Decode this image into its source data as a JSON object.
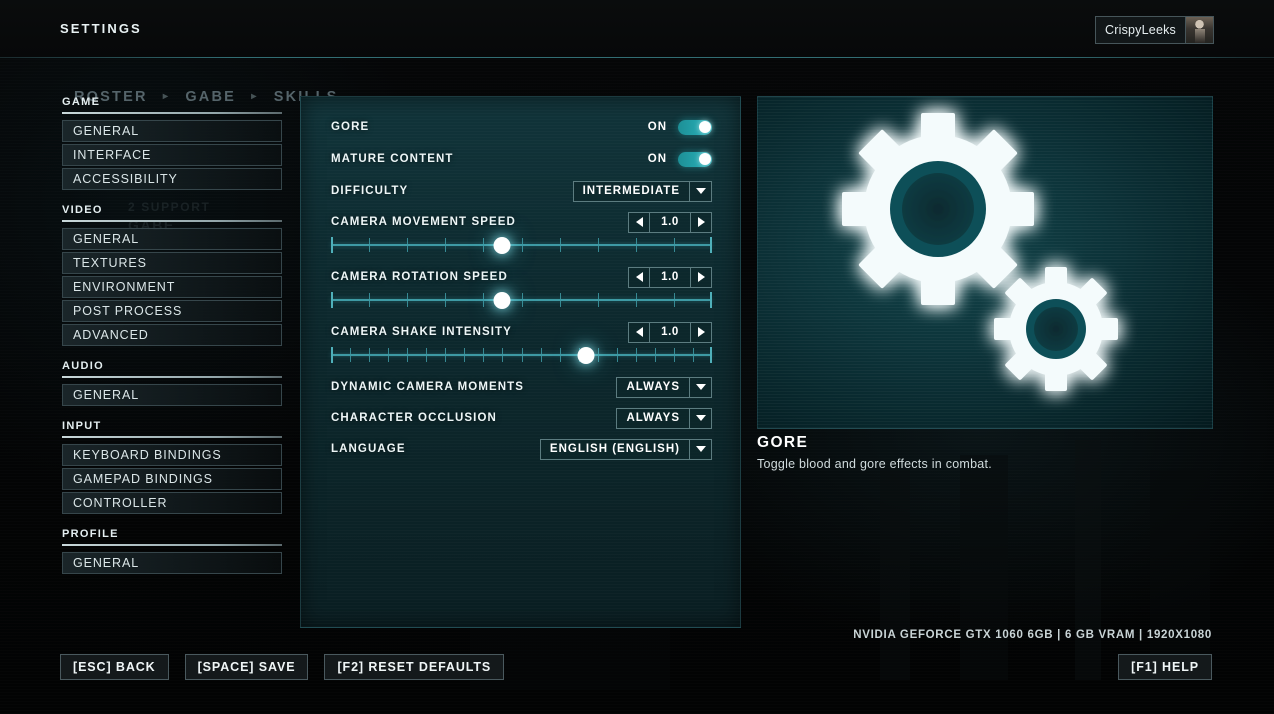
{
  "topbar": {
    "title": "SETTINGS",
    "user": {
      "name": "CrispyLeeks",
      "avatar_icon": "character-portrait-icon"
    }
  },
  "breadcrumb": {
    "items": [
      "ROSTER",
      "GABE",
      "SKILLS"
    ],
    "separator": "▸"
  },
  "background_ghost": {
    "support_label": "2 SUPPORT",
    "gabe_label": "GABE"
  },
  "sidebar": {
    "groups": [
      {
        "title": "GAME",
        "items": [
          "GENERAL",
          "INTERFACE",
          "ACCESSIBILITY"
        ]
      },
      {
        "title": "VIDEO",
        "items": [
          "GENERAL",
          "TEXTURES",
          "ENVIRONMENT",
          "POST PROCESS",
          "ADVANCED"
        ]
      },
      {
        "title": "AUDIO",
        "items": [
          "GENERAL"
        ]
      },
      {
        "title": "INPUT",
        "items": [
          "KEYBOARD BINDINGS",
          "GAMEPAD BINDINGS",
          "CONTROLLER"
        ]
      },
      {
        "title": "PROFILE",
        "items": [
          "GENERAL"
        ]
      }
    ]
  },
  "options": [
    {
      "type": "toggle",
      "label": "GORE",
      "value": "ON",
      "on": true
    },
    {
      "type": "toggle",
      "label": "MATURE CONTENT",
      "value": "ON",
      "on": true
    },
    {
      "type": "dropdown",
      "label": "DIFFICULTY",
      "value": "INTERMEDIATE"
    },
    {
      "type": "slider",
      "label": "CAMERA MOVEMENT SPEED",
      "value": "1.0",
      "percent": 45,
      "ticks": 10
    },
    {
      "type": "slider",
      "label": "CAMERA ROTATION SPEED",
      "value": "1.0",
      "percent": 45,
      "ticks": 10
    },
    {
      "type": "slider",
      "label": "CAMERA SHAKE INTENSITY",
      "value": "1.0",
      "percent": 67,
      "ticks": 20
    },
    {
      "type": "dropdown",
      "label": "DYNAMIC CAMERA MOMENTS",
      "value": "ALWAYS"
    },
    {
      "type": "dropdown",
      "label": "CHARACTER OCCLUSION",
      "value": "ALWAYS"
    },
    {
      "type": "dropdown",
      "label": "LANGUAGE",
      "value": "ENGLISH (ENGLISH)"
    }
  ],
  "preview": {
    "image_icon": "gears-icon",
    "title": "GORE",
    "description": "Toggle blood and gore effects in combat."
  },
  "footer": {
    "hardware_info": "NVIDIA GEFORCE GTX 1060 6GB | 6 GB VRAM | 1920X1080",
    "buttons": [
      "[ESC] BACK",
      "[SPACE] SAVE",
      "[F2] RESET DEFAULTS"
    ],
    "help_button": "[F1] HELP"
  },
  "colors": {
    "accent": "#2ab4bd",
    "panel_bg": "#0d2a2f",
    "text": "#eef6f7",
    "muted": "#4d5a5e"
  }
}
